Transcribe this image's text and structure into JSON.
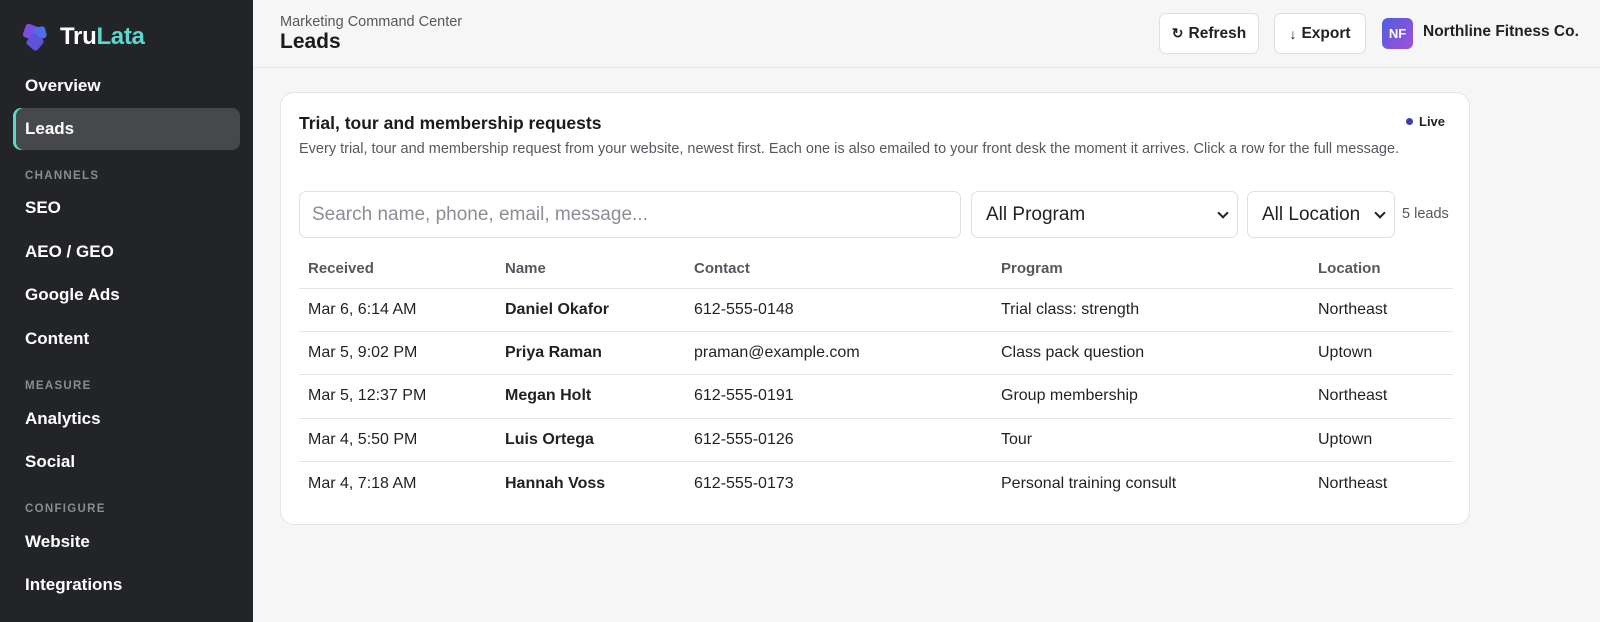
{
  "brand": {
    "part1": "Tru",
    "part2": "Lata"
  },
  "sidebar": {
    "items": [
      {
        "label": "Overview",
        "active": false
      },
      {
        "label": "Leads",
        "active": true
      },
      {
        "label": "SEO",
        "active": false
      },
      {
        "label": "AEO / GEO",
        "active": false
      },
      {
        "label": "Google Ads",
        "active": false
      },
      {
        "label": "Content",
        "active": false
      },
      {
        "label": "Analytics",
        "active": false
      },
      {
        "label": "Social",
        "active": false
      },
      {
        "label": "Website",
        "active": false
      },
      {
        "label": "Integrations",
        "active": false
      }
    ],
    "sections": [
      "CHANNELS",
      "MEASURE",
      "CONFIGURE"
    ]
  },
  "header": {
    "breadcrumb": "Marketing Command Center",
    "title": "Leads",
    "refresh_label": "Refresh",
    "export_label": "Export",
    "avatar_initials": "NF",
    "org_name": "Northline Fitness Co."
  },
  "card": {
    "title": "Trial, tour and membership requests",
    "live_label": "Live",
    "description": "Every trial, tour and membership request from your website, newest first. Each one is also emailed to your front desk the moment it arrives. Click a row for the full message.",
    "search_placeholder": "Search name, phone, email, message...",
    "program_filter": "All Program",
    "location_filter": "All Location",
    "lead_count": "5 leads"
  },
  "table": {
    "columns": [
      "Received",
      "Name",
      "Contact",
      "Program",
      "Location"
    ],
    "rows": [
      {
        "received": "Mar 6, 6:14 AM",
        "name": "Daniel Okafor",
        "contact": "612-555-0148",
        "program": "Trial class: strength",
        "location": "Northeast"
      },
      {
        "received": "Mar 5, 9:02 PM",
        "name": "Priya Raman",
        "contact": "praman@example.com",
        "program": "Class pack question",
        "location": "Uptown"
      },
      {
        "received": "Mar 5, 12:37 PM",
        "name": "Megan Holt",
        "contact": "612-555-0191",
        "program": "Group membership",
        "location": "Northeast"
      },
      {
        "received": "Mar 4, 5:50 PM",
        "name": "Luis Ortega",
        "contact": "612-555-0126",
        "program": "Tour",
        "location": "Uptown"
      },
      {
        "received": "Mar 4, 7:18 AM",
        "name": "Hannah Voss",
        "contact": "612-555-0173",
        "program": "Personal training consult",
        "location": "Northeast"
      }
    ]
  },
  "colors": {
    "sidebar_bg": "#232427",
    "accent": "#5fd6cd",
    "live_dot": "#3b3fa8",
    "avatar_start": "#4c5fe0",
    "avatar_end": "#a34fd8"
  },
  "icons": {
    "logo": "logo-mark-icon",
    "refresh": "refresh-icon",
    "export": "download-arrow-icon",
    "select": "chevron-down-icon"
  }
}
